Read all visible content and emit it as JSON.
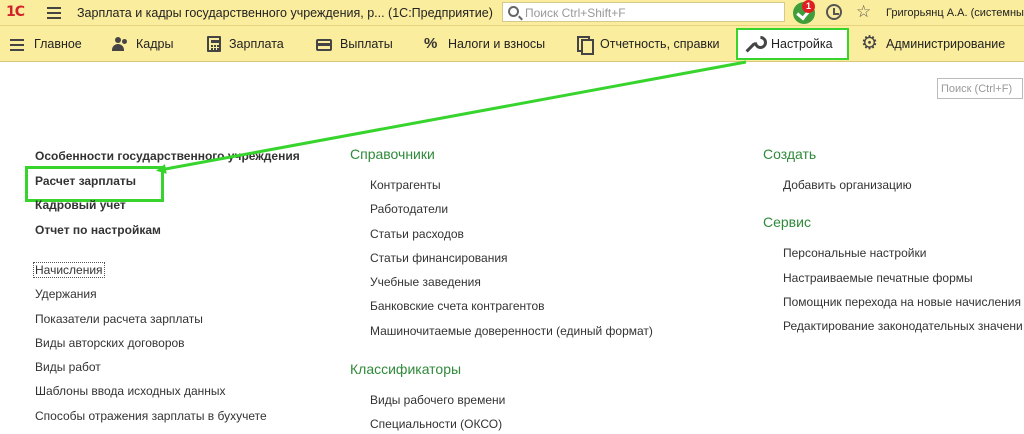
{
  "titlebar": {
    "logo": "1С",
    "title": "Зарплата и кадры государственного учреждения, р...  (1С:Предприятие)",
    "search_placeholder": "Поиск Ctrl+Shift+F",
    "notifications_count": "1",
    "user": "Григорьянц А.А. (системный"
  },
  "sections": [
    {
      "label": "Главное",
      "icon": "menu-icon"
    },
    {
      "label": "Кадры",
      "icon": "people-icon"
    },
    {
      "label": "Зарплата",
      "icon": "calculator-icon"
    },
    {
      "label": "Выплаты",
      "icon": "card-icon"
    },
    {
      "label": "Налоги и взносы",
      "icon": "percent-icon"
    },
    {
      "label": "Отчетность, справки",
      "icon": "documents-icon"
    },
    {
      "label": "Настройка",
      "icon": "wrench-icon",
      "active": true
    },
    {
      "label": "Администрирование",
      "icon": "gear-icon"
    }
  ],
  "local_search_placeholder": "Поиск (Ctrl+F)",
  "left": {
    "headers": [
      "Особенности государственного учреждения",
      "Расчет зарплаты",
      "Кадровый учет",
      "Отчет по настройкам"
    ],
    "items": [
      "Начисления",
      "Удержания",
      "Показатели расчета зарплаты",
      "Виды авторских договоров",
      "Виды работ",
      "Шаблоны ввода исходных данных",
      "Способы отражения зарплаты в бухучете"
    ]
  },
  "middle": {
    "group1_title": "Справочники",
    "group1_items": [
      "Контрагенты",
      "Работодатели",
      "Статьи расходов",
      "Статьи финансирования",
      "Учебные заведения",
      "Банковские счета контрагентов",
      "Машиночитаемые доверенности (единый формат)"
    ],
    "group2_title": "Классификаторы",
    "group2_items": [
      "Виды рабочего времени",
      "Специальности (ОКСО)"
    ]
  },
  "right": {
    "group1_title": "Создать",
    "group1_items": [
      "Добавить организацию"
    ],
    "group2_title": "Сервис",
    "group2_items": [
      "Персональные настройки",
      "Настраиваемые печатные формы",
      "Помощник перехода на новые начисления",
      "Редактирование законодательных значени"
    ]
  },
  "colors": {
    "bar_bg": "#fbed9e",
    "highlight": "#37d42d",
    "group_title": "#2f8a3a"
  }
}
